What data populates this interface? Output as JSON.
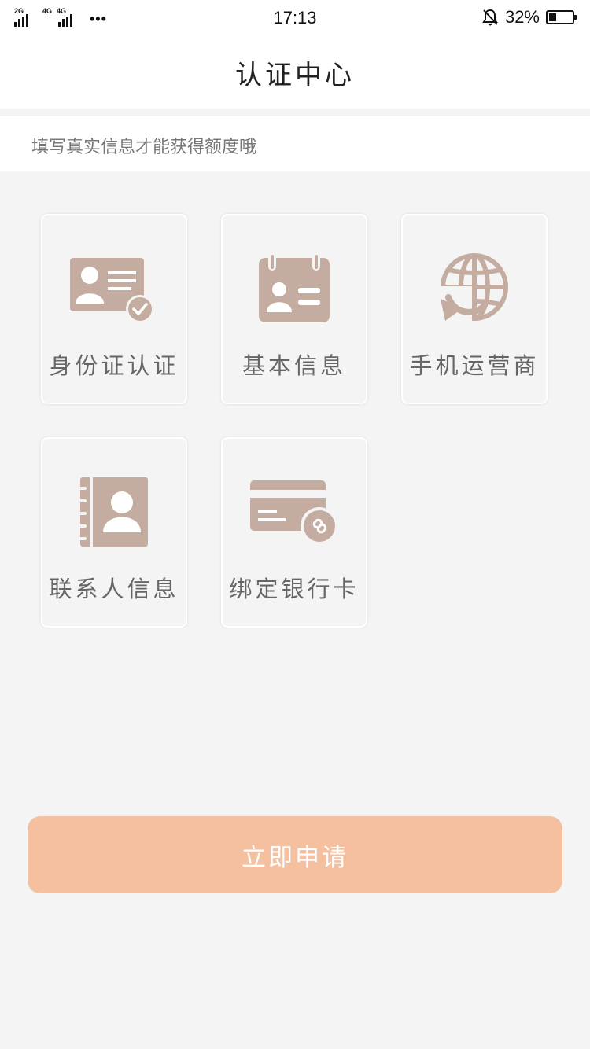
{
  "status_bar": {
    "network_1": "2G",
    "network_2": "4G",
    "network_3": "4G",
    "more": "•••",
    "time": "17:13",
    "battery_percent": "32%",
    "battery_level": 0.32
  },
  "header": {
    "title": "认证中心"
  },
  "tip": {
    "text": "填写真实信息才能获得额度哦"
  },
  "cards": [
    {
      "label": "身份证认证",
      "icon": "id-card-check-icon"
    },
    {
      "label": "基本信息",
      "icon": "profile-badge-icon"
    },
    {
      "label": "手机运营商",
      "icon": "globe-refresh-icon"
    },
    {
      "label": "联系人信息",
      "icon": "contacts-book-icon"
    },
    {
      "label": "绑定银行卡",
      "icon": "bank-card-link-icon"
    }
  ],
  "apply_button": {
    "label": "立即申请"
  },
  "colors": {
    "icon": "#c4ada0",
    "button": "#f5c0a0",
    "background": "#f4f4f4"
  }
}
